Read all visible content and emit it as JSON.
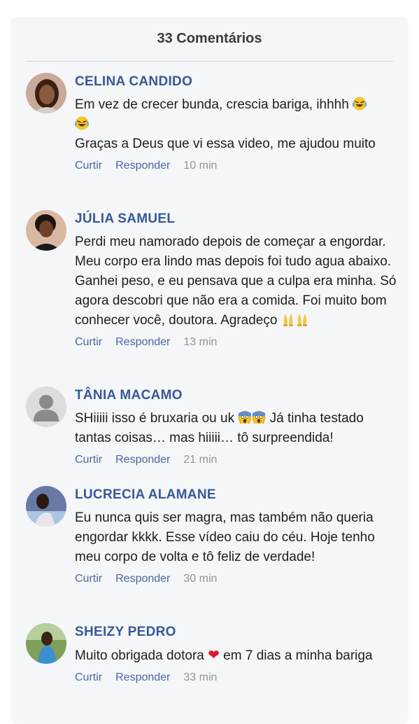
{
  "header": {
    "title": "33 Comentários"
  },
  "actions": {
    "like": "Curtir",
    "reply": "Responder"
  },
  "comments": [
    {
      "name": "CELINA CANDIDO",
      "text1_a": "Em vez de crecer bunda, crescia bariga, ihhhh",
      "text2": "Graças a Deus que vi essa video, me ajudou muito",
      "time": "10 min",
      "emoji": "laughing-face"
    },
    {
      "name": "JÚLIA SAMUEL",
      "text1_a": "Perdi meu namorado depois de começar a engordar. Meu corpo era lindo mas depois foi tudo agua abaixo. Ganhei peso, e eu pensava que a culpa era minha. Só agora descobri que não era a comida. Foi muito bom conhecer você, doutora. Agradeço",
      "time": "13 min",
      "emoji": "praying-hands"
    },
    {
      "name": "TÂNIA MACAMO",
      "text1_a": "SHiiiii isso é bruxaria ou uk",
      "text1_b": "Já tinha testado tantas coisas… mas hiiiii… tô surpreendida!",
      "time": "21 min",
      "emoji": "screaming-face"
    },
    {
      "name": "LUCRECIA ALAMANE",
      "text1_a": "Eu nunca quis ser magra, mas também não queria engordar kkkk. Esse vídeo caiu do céu. Hoje tenho meu corpo de volta e tô feliz de verdade!",
      "time": "30 min"
    },
    {
      "name": "SHEIZY PEDRO",
      "text1_a": "Muito obrigada dotora",
      "text1_b": "em 7 dias a minha bariga",
      "time": "33 min",
      "emoji": "red-heart"
    }
  ],
  "colors": {
    "name": "#385898",
    "link": "#4b67a1",
    "time": "#90949c",
    "panel": "#f5f6f7"
  }
}
